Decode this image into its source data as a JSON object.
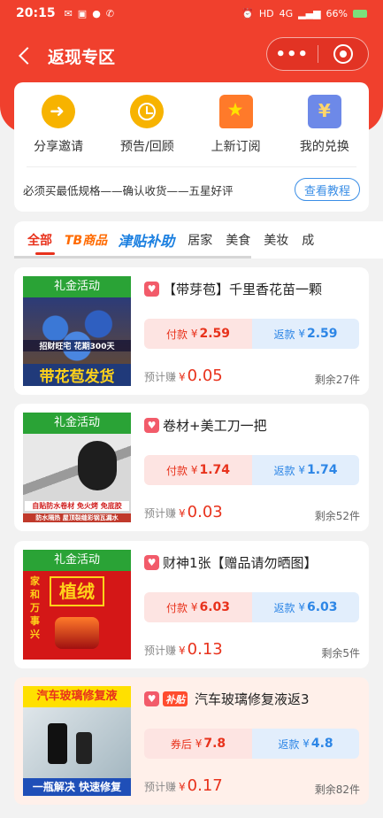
{
  "status_bar": {
    "time": "20:15",
    "battery": "66%",
    "signal": "4G",
    "hd": "HD"
  },
  "nav": {
    "title": "返现专区",
    "more": "•••"
  },
  "quick_actions": [
    {
      "label": "分享邀请",
      "icon": "share-arrow-icon"
    },
    {
      "label": "预告/回顾",
      "icon": "alarm-clock-icon"
    },
    {
      "label": "上新订阅",
      "icon": "star-bookmark-icon"
    },
    {
      "label": "我的兑换",
      "icon": "yen-exchange-icon"
    }
  ],
  "rule_text": "必须买最低规格——确认收货——五星好评",
  "tutorial_label": "查看教程",
  "tabs": [
    "全部",
    "TB商品",
    "津贴补助",
    "居家",
    "美食",
    "美妆",
    "成"
  ],
  "products": [
    {
      "banner": "礼金活动",
      "image_caption": "带花苞发货",
      "image_text": "招财旺宅 花期300天",
      "title": "【带芽苞】千里香花苗一颗",
      "pay_label": "付款",
      "pay": "2.59",
      "return_label": "返款",
      "return": "2.59",
      "earn_label": "预计赚",
      "earn": "0.05",
      "stock": "剩余27件"
    },
    {
      "banner": "礼金活动",
      "image_caption": "防水隔热 屋顶裂缝彩钢瓦漏水",
      "image_text": "自贴防水卷材 免火烤 免底胶",
      "title": "卷材+美工刀一把",
      "pay_label": "付款",
      "pay": "1.74",
      "return_label": "返款",
      "return": "1.74",
      "earn_label": "预计赚",
      "earn": "0.03",
      "stock": "剩余52件"
    },
    {
      "banner": "礼金活动",
      "image_caption": "植绒",
      "image_text": "家和万事兴",
      "title": "财神1张【赠品请勿晒图】",
      "pay_label": "付款",
      "pay": "6.03",
      "return_label": "返款",
      "return": "6.03",
      "earn_label": "预计赚",
      "earn": "0.13",
      "stock": "剩余5件"
    },
    {
      "banner": "汽车玻璃修复液",
      "image_caption": "一瓶解决 快速修复",
      "image_text": "",
      "tag": "补贴",
      "title": "汽车玻璃修复液返3",
      "pay_label": "券后",
      "pay": "7.8",
      "return_label": "返款",
      "return": "4.8",
      "earn_label": "预计赚",
      "earn": "0.17",
      "stock": "剩余82件"
    }
  ],
  "currency": "¥",
  "colors": {
    "brand_red": "#f0402d",
    "accent_blue": "#3a8ee6",
    "price_red": "#e8321c"
  }
}
